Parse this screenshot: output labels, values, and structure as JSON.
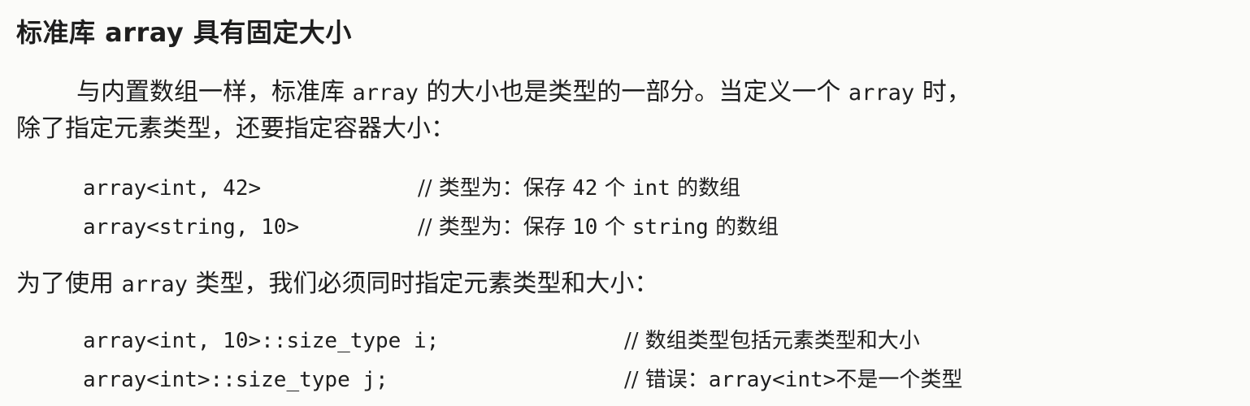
{
  "section_title": "标准库 array 具有固定大小",
  "paragraph1": {
    "line1_before": "与内置数组一样，标准库 ",
    "line1_code1": "array",
    "line1_middle": " 的大小也是类型的一部分。当定义一个 ",
    "line1_code2": "array",
    "line1_after": " 时，",
    "line2": "除了指定元素类型，还要指定容器大小："
  },
  "code_block1": [
    {
      "code": "array<int, 42>",
      "comment_prefix": "// 类型为：保存 ",
      "comment_mono": "42",
      "comment_mid": " 个 ",
      "comment_mono2": "int",
      "comment_suffix": " 的数组"
    },
    {
      "code": "array<string, 10>",
      "comment_prefix": "// 类型为：保存 ",
      "comment_mono": "10",
      "comment_mid": " 个 ",
      "comment_mono2": "string",
      "comment_suffix": " 的数组"
    }
  ],
  "paragraph2": {
    "before": "为了使用 ",
    "code": "array",
    "after": " 类型，我们必须同时指定元素类型和大小："
  },
  "code_block2": [
    {
      "code": "array<int, 10>::size_type i;",
      "comment_prefix": "// 数组类型包括元素类型和大小",
      "comment_mono": "",
      "comment_suffix": ""
    },
    {
      "code": "array<int>::size_type j;",
      "comment_prefix": "// 错误：",
      "comment_mono": "array<int>",
      "comment_suffix": "不是一个类型"
    }
  ]
}
